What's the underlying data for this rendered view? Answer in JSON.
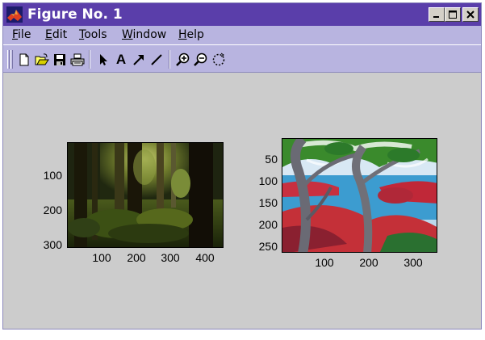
{
  "window": {
    "title": "Figure No. 1",
    "colors": {
      "titlebar": "#5a3eaa",
      "menubar": "#b8b4e0",
      "figure_bg": "#cccccc"
    }
  },
  "menu": [
    {
      "mnemonic": "F",
      "rest": "ile"
    },
    {
      "mnemonic": "E",
      "rest": "dit"
    },
    {
      "mnemonic": "T",
      "rest": "ools"
    },
    {
      "mnemonic": "W",
      "rest": "indow"
    },
    {
      "mnemonic": "H",
      "rest": "elp"
    }
  ],
  "toolbar": {
    "icons": [
      "new-file-icon",
      "open-folder-icon",
      "save-icon",
      "print-icon",
      "arrow-select-icon",
      "text-insert-icon",
      "arrow-insert-icon",
      "line-insert-icon",
      "zoom-in-icon",
      "zoom-out-icon",
      "rotate-icon"
    ],
    "text_tool_label": "A"
  },
  "axes": [
    {
      "image": "forest-photo",
      "yticks": [
        "100",
        "200",
        "300"
      ],
      "xticks": [
        "100",
        "200",
        "300",
        "400"
      ]
    },
    {
      "image": "painted-trees-by-lake",
      "yticks": [
        "50",
        "100",
        "150",
        "200",
        "250"
      ],
      "xticks": [
        "100",
        "200",
        "300"
      ]
    }
  ]
}
